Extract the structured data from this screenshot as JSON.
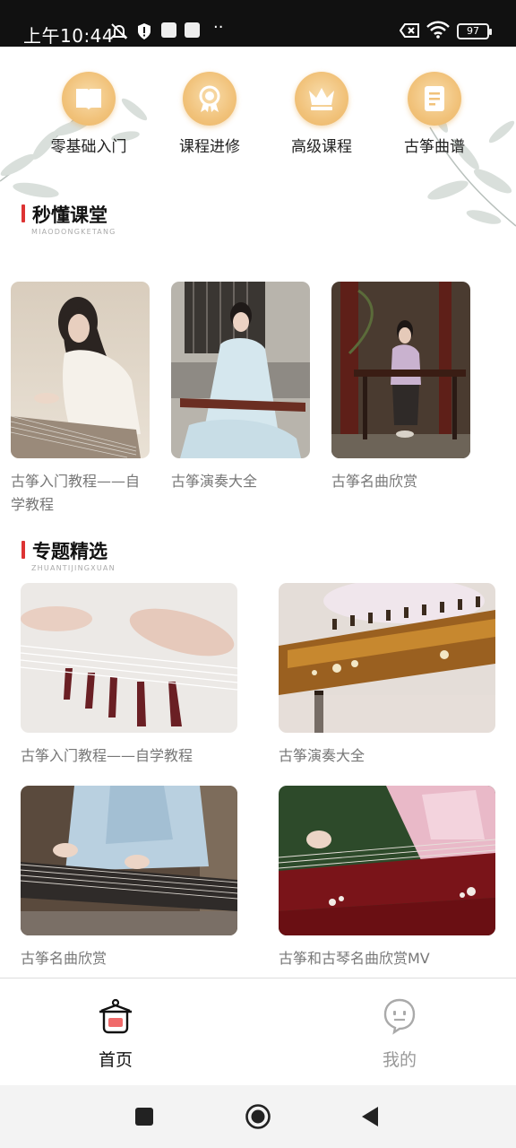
{
  "status_bar": {
    "time": "上午10:44",
    "battery": "97",
    "icons": [
      "mute-bell-icon",
      "shield-alert-icon",
      "app-notification-icon",
      "app-notification-icon",
      "more-dots-icon",
      "battery-x-icon",
      "wifi-icon",
      "battery-icon"
    ]
  },
  "categories": [
    {
      "label": "零基础入门",
      "icon": "book-icon"
    },
    {
      "label": "课程进修",
      "icon": "medal-icon"
    },
    {
      "label": "高级课程",
      "icon": "crown-icon"
    },
    {
      "label": "古筝曲谱",
      "icon": "score-icon"
    }
  ],
  "section_quick": {
    "title": "秒懂课堂",
    "subtitle": "MIAODONGKETANG"
  },
  "quick_videos": [
    {
      "caption": "古筝入门教程——自学教程"
    },
    {
      "caption": "古筝演奏大全"
    },
    {
      "caption": "古筝名曲欣赏"
    }
  ],
  "section_topics": {
    "title": "专题精选",
    "subtitle": "ZHUANTIJINGXUAN"
  },
  "topics": [
    {
      "caption": "古筝入门教程——自学教程"
    },
    {
      "caption": "古筝演奏大全"
    },
    {
      "caption": "古筝名曲欣赏"
    },
    {
      "caption": "古筝和古琴名曲欣赏MV"
    }
  ],
  "bottom_nav": {
    "home": "首页",
    "mine": "我的",
    "active": "home"
  },
  "colors": {
    "accent_red": "#d33333",
    "category_gold": "#f1c27a",
    "caption_gray": "#777777",
    "status_bar_bg": "#111111"
  }
}
